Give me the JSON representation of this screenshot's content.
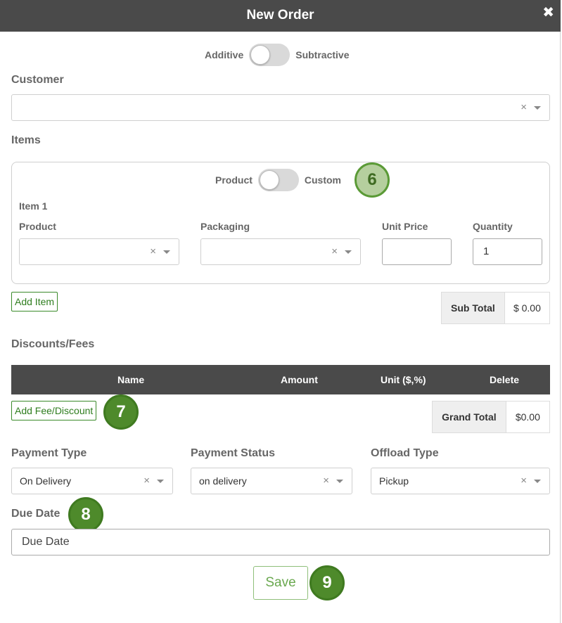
{
  "header": {
    "title": "New Order",
    "close_icon": "close-icon"
  },
  "mode_toggle": {
    "left_label": "Additive",
    "right_label": "Subtractive"
  },
  "customer": {
    "label": "Customer",
    "value": ""
  },
  "items": {
    "label": "Items",
    "type_toggle": {
      "left_label": "Product",
      "right_label": "Custom"
    },
    "item_title": "Item 1",
    "columns": {
      "product": "Product",
      "packaging": "Packaging",
      "unit_price": "Unit Price",
      "quantity": "Quantity"
    },
    "product_value": "",
    "packaging_value": "",
    "unit_price_value": "",
    "quantity_value": "1",
    "add_item_label": "Add Item",
    "subtotal": {
      "label": "Sub Total",
      "value": "$ 0.00"
    }
  },
  "fees": {
    "label": "Discounts/Fees",
    "columns": {
      "name": "Name",
      "amount": "Amount",
      "unit": "Unit ($,%)",
      "delete": "Delete"
    },
    "add_label": "Add Fee/Discount",
    "grand_total": {
      "label": "Grand Total",
      "value": "$0.00"
    }
  },
  "payment_type": {
    "label": "Payment Type",
    "value": "On Delivery"
  },
  "payment_status": {
    "label": "Payment Status",
    "value": "on delivery"
  },
  "offload_type": {
    "label": "Offload Type",
    "value": "Pickup"
  },
  "due_date": {
    "label": "Due Date",
    "placeholder": "Due Date"
  },
  "save_label": "Save",
  "badges": {
    "b6": "6",
    "b7": "7",
    "b8": "8",
    "b9": "9"
  },
  "colors": {
    "header_bg": "#4a4a4a",
    "accent_green": "#4e8a2b",
    "button_green": "#2e7d1e"
  }
}
